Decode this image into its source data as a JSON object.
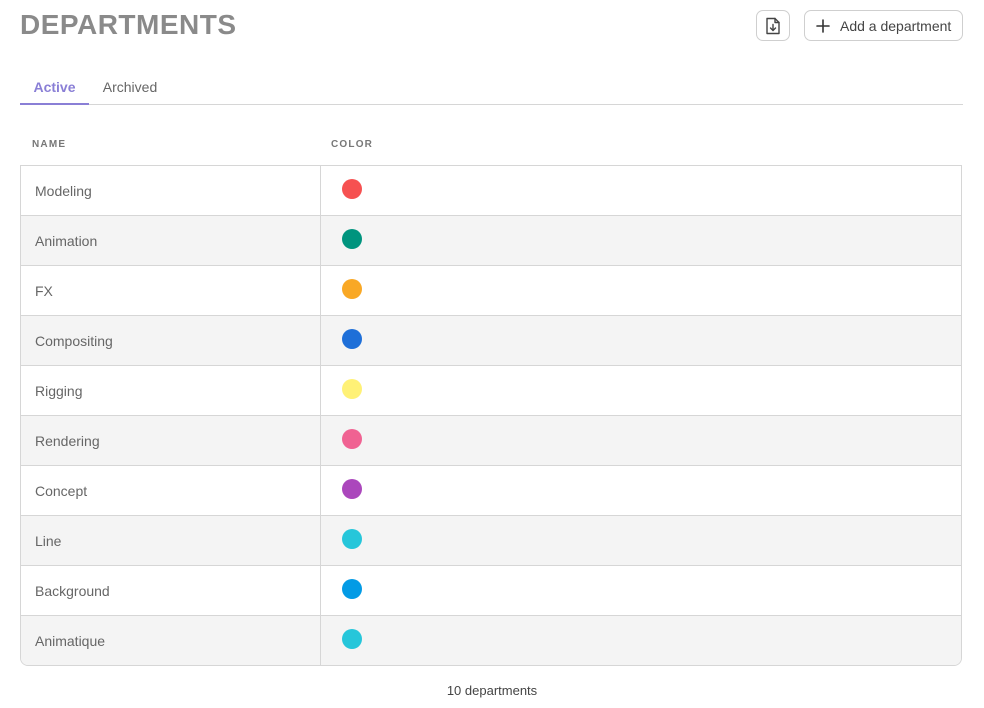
{
  "header": {
    "title": "DEPARTMENTS",
    "add_label": "Add a department",
    "export_icon": "file-download-icon",
    "add_icon": "plus-icon"
  },
  "tabs": [
    {
      "label": "Active",
      "active": true
    },
    {
      "label": "Archived",
      "active": false
    }
  ],
  "table": {
    "columns": [
      "NAME",
      "COLOR"
    ],
    "rows": [
      {
        "name": "Modeling",
        "color": "#f65151"
      },
      {
        "name": "Animation",
        "color": "#00947e"
      },
      {
        "name": "FX",
        "color": "#f9a825"
      },
      {
        "name": "Compositing",
        "color": "#1e6fd8"
      },
      {
        "name": "Rigging",
        "color": "#fff176"
      },
      {
        "name": "Rendering",
        "color": "#f06292"
      },
      {
        "name": "Concept",
        "color": "#ab47bc"
      },
      {
        "name": "Line",
        "color": "#26c6da"
      },
      {
        "name": "Background",
        "color": "#039be5"
      },
      {
        "name": "Animatique",
        "color": "#26c6da"
      }
    ]
  },
  "footer": {
    "count_label": "10 departments"
  },
  "colors": {
    "accent": "#8a7fd6",
    "border": "#d6d6d6",
    "row_alt": "#f4f4f4"
  }
}
